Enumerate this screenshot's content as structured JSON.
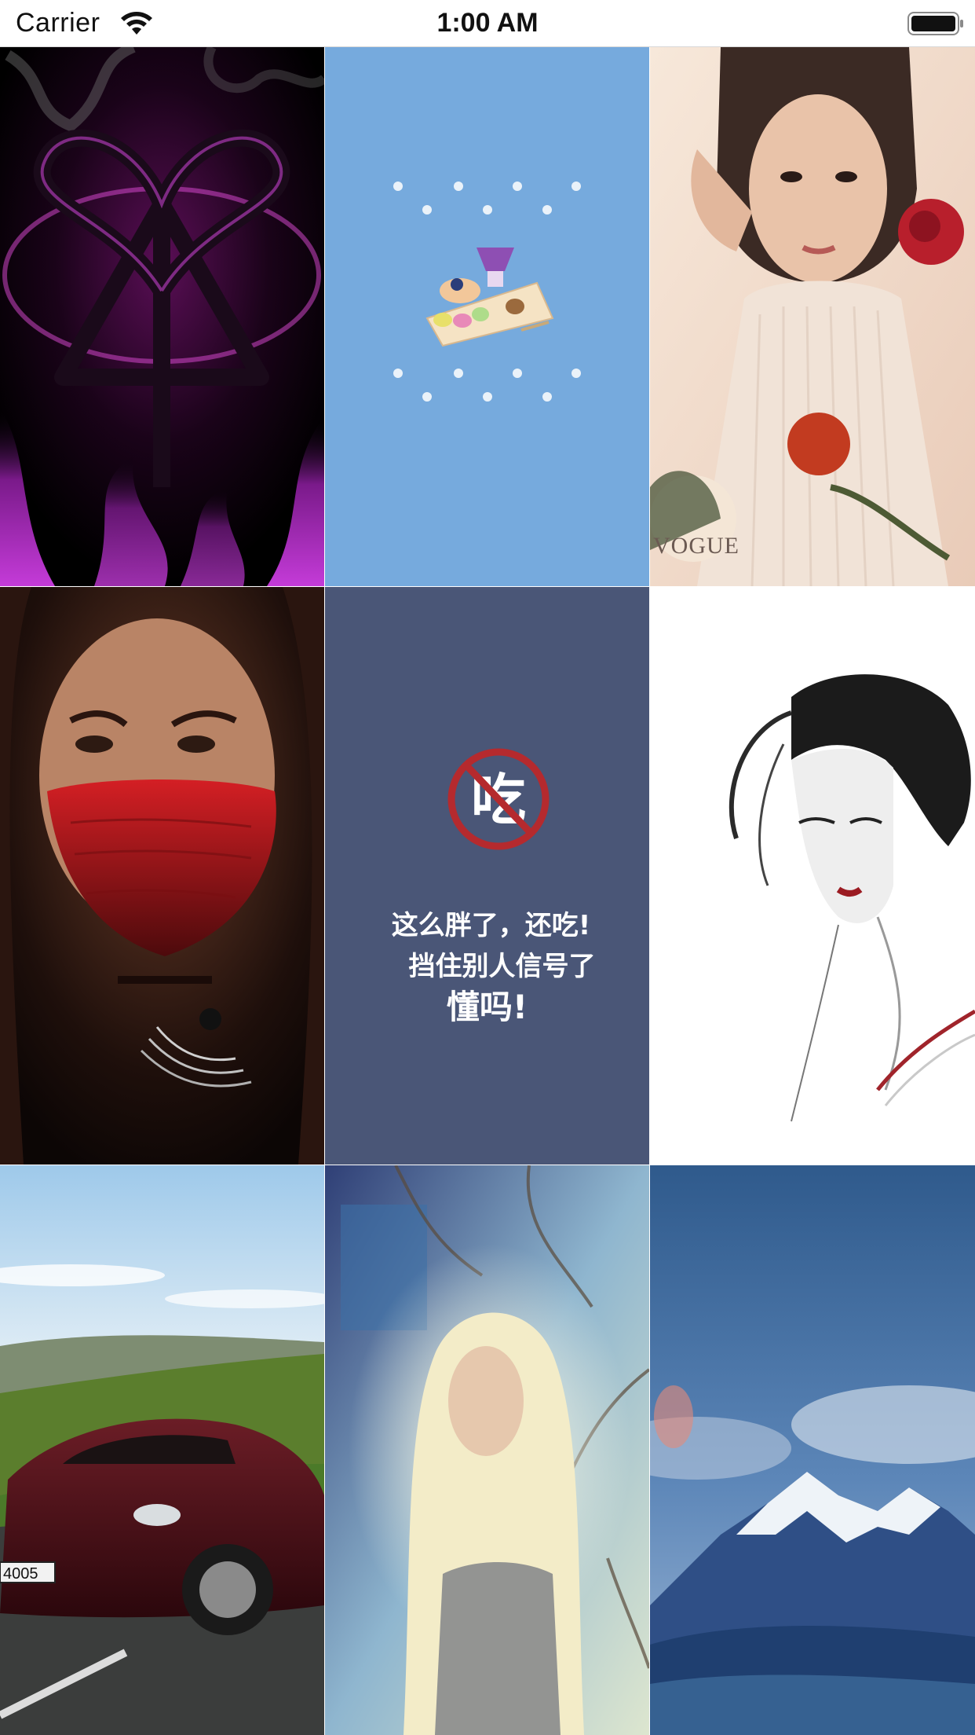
{
  "status_bar": {
    "carrier": "Carrier",
    "time": "1:00 AM",
    "icons": [
      "wifi-icon",
      "battery-icon"
    ]
  },
  "grid": {
    "columns": 3,
    "rows": 3,
    "tiles": [
      {
        "name": "heartagram-wallpaper"
      },
      {
        "name": "dessert-wallpaper"
      },
      {
        "name": "woman-rose-wallpaper",
        "caption": "VOGUE"
      },
      {
        "name": "masked-woman-wallpaper"
      },
      {
        "name": "no-eating-notice-wallpaper",
        "icon_text": "吃",
        "lines": [
          "这么胖了，还吃!",
          "挡住别人信号了",
          "懂吗!"
        ]
      },
      {
        "name": "ink-woman-wallpaper"
      },
      {
        "name": "car-wallpaper",
        "plate_text": "4005"
      },
      {
        "name": "blonde-woman-wallpaper"
      },
      {
        "name": "mountain-wallpaper"
      }
    ]
  },
  "colors": {
    "dessert_bg": "#76aadd",
    "notice_bg": "#4a5677",
    "no_sign_red": "#b52a2e"
  }
}
